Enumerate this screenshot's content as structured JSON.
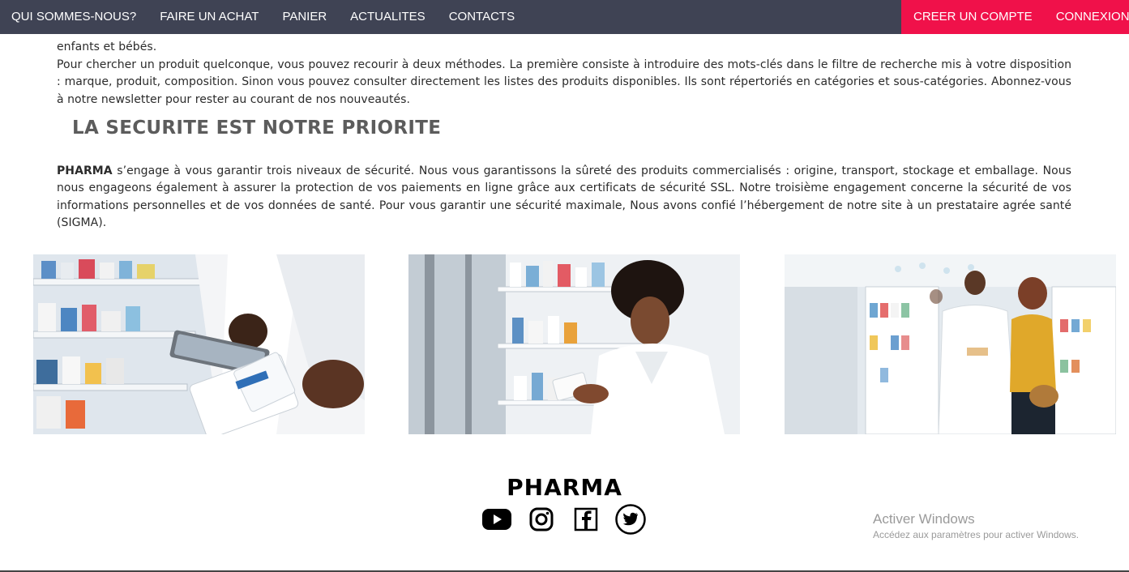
{
  "nav": {
    "items": [
      "QUI SOMMES-NOUS?",
      "FAIRE UN ACHAT",
      "PANIER",
      "ACTUALITES",
      "CONTACTS"
    ],
    "create_account": "CREER UN COMPTE",
    "login": "CONNEXION",
    "colors": {
      "bar": "#3f4354",
      "accent": "#f0114a"
    }
  },
  "intro": {
    "line_tail": "enfants et bébés.",
    "search_paragraph": "Pour chercher un produit quelconque, vous pouvez recourir à deux méthodes. La première consiste à introduire des mots-clés dans le filtre de recherche mis à votre disposition : marque, produit, composition. Sinon vous pouvez consulter directement les listes des produits disponibles. Ils sont répertoriés en catégories et sous-catégories. Abonnez-vous à notre newsletter pour rester au courant de nos nouveautés."
  },
  "security": {
    "heading": "LA SECURITE EST NOTRE PRIORITE",
    "brand": "PHARMA",
    "text": " s’engage à vous garantir trois niveaux de sécurité. Nous vous garantissons la sûreté des produits commercialisés : origine, transport, stockage et emballage. Nous nous engageons également à assurer la protection de vos paiements en ligne grâce aux certificats de sécurité SSL. Notre troisième engagement concerne la sécurité de vos informations personnelles et de vos données de santé. Pour vous garantir une sécurité maximale, Nous avons confié l’hébergement de notre site à un prestataire agrée santé (SIGMA)."
  },
  "footer": {
    "brand": "PHARMA",
    "socials": [
      "youtube-icon",
      "instagram-icon",
      "facebook-icon",
      "twitter-icon"
    ]
  },
  "watermark": {
    "title": "Activer Windows",
    "subtitle": "Accédez aux paramètres pour activer Windows."
  }
}
